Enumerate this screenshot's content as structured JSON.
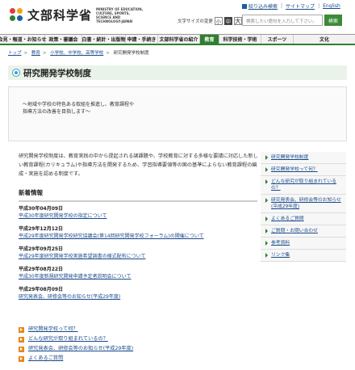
{
  "header": {
    "site_title": "文部科学省",
    "site_title_en": "MINISTRY OF EDUCATION, CULTURE, SPORTS, SCIENCE AND TECHNOLOGY-JAPAN",
    "top_links": [
      "絞り込み検索",
      "サイトマップ",
      "English"
    ],
    "text_size_label": "文字サイズの変更",
    "text_size_buttons": [
      "小",
      "中",
      "大"
    ],
    "search_placeholder": "検索したい語句を入力して下さい。",
    "search_button": "検索"
  },
  "nav": {
    "items": [
      "会見・報道・お知らせ",
      "政策・審議会",
      "白書・統計・出版物",
      "申請・手続き",
      "文部科学省の紹介",
      "教育",
      "科学技術・学術",
      "スポーツ",
      "文化"
    ],
    "active_index": 5
  },
  "breadcrumb": [
    "トップ",
    "教育",
    "小学校、中学校、高等学校",
    "研究開発学校制度"
  ],
  "page": {
    "title": "研究開発学校制度",
    "lead_line1": "～地域や学校の特色ある取組を推進し、教育課程や",
    "lead_line2": "指導方法の改善を目指します～",
    "intro": "研究開発学校制度は、教育実践の中から提起される諸課題や、学校教育に対する多様な要請に対応した新しい教育課程(カリキュラム)や指導方法を開発するため、学習指導要領等の国の基準によらない教育課程の編成・実施を認める制度です。"
  },
  "news": {
    "heading": "新着情報",
    "items": [
      {
        "date": "平成30年04月09日",
        "text": "平成30年度研究開発学校の指定について"
      },
      {
        "date": "平成29年12月12日",
        "text": "平成29年度研究開発学校研究協議会(第14回研究開発学校フォーラム)の開催について"
      },
      {
        "date": "平成29年09月25日",
        "text": "平成29年度研究開発学校実施希望調書の様式配布について"
      },
      {
        "date": "平成29年08月22日",
        "text": "平成30年度新規研究開発申請予定者説明会について"
      },
      {
        "date": "平成29年08月09日",
        "text": "研究発表会、研修会等のお知らせ(平成29年度)"
      }
    ]
  },
  "bottom_links": [
    "研究開発学校って何？",
    "どんな研究が取り組まれているの？",
    "研究発表会、研修会等のお知らせ(平成29年度)",
    "よくあるご質問"
  ],
  "sidebar": {
    "items": [
      "研究開発学校制度",
      "研究開発学校って何？",
      "どんな研究が取り組まれているの？",
      "研究発表会、研修会等のお知らせ(平成29年度)",
      "よくあるご質問",
      "ご質問・お問い合わせ",
      "参考資料",
      "リンク集"
    ]
  },
  "colors": {
    "accent_green": "#2f7f2f",
    "link_blue": "#1a4a8a",
    "arrow_orange": "#e8851b"
  }
}
